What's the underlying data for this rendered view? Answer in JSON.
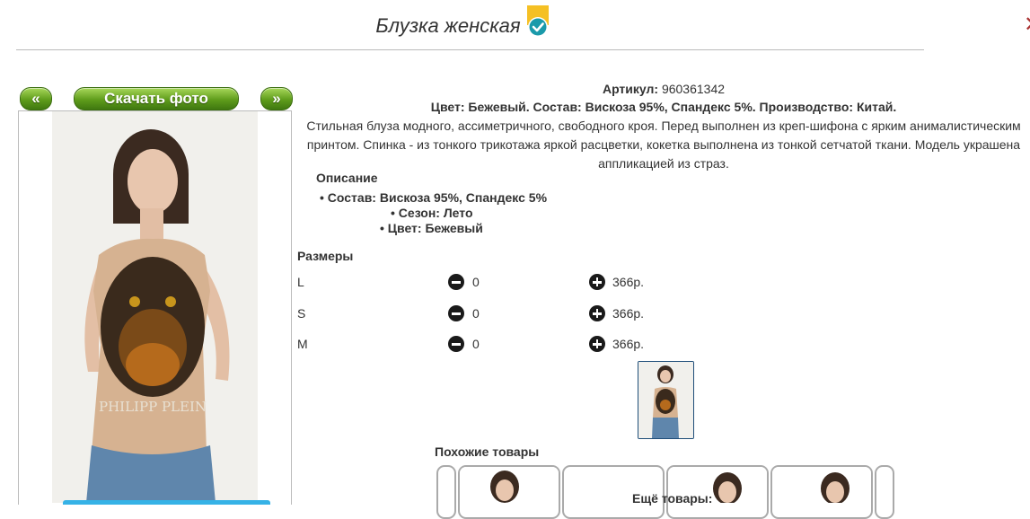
{
  "header": {
    "title": "Блузка женская"
  },
  "gallery": {
    "prev_label": "«",
    "download_label": "Скачать фото",
    "next_label": "»"
  },
  "product": {
    "article_label": "Артикул:",
    "article_value": "960361342",
    "spec_line": "Цвет: Бежевый. Состав: Вискоза 95%, Спандекс 5%. Производство: Китай.",
    "description_line1": "Стильная блуза модного, ассиметричного, свободного кроя. Перед выполнен из креп-шифона с ярким анималистическим",
    "description_line2": "принтом. Спинка - из тонкого трикотажа яркой расцветки, кокетка выполнена из тонкой сетчатой ткани. Модель украшена",
    "description_line3": "аппликацией из страз.",
    "features_title": "Описание",
    "features": [
      "Состав: Вискоза 95%, Спандекс 5%",
      "Сезон: Лето",
      "Цвет: Бежевый"
    ],
    "print_text": "PHILIPP PLEIN"
  },
  "sizes": {
    "title": "Размеры",
    "rows": [
      {
        "size": "L",
        "qty": "0",
        "price": "366р."
      },
      {
        "size": "S",
        "qty": "0",
        "price": "366р."
      },
      {
        "size": "M",
        "qty": "0",
        "price": "366р."
      }
    ]
  },
  "related": {
    "similar_title": "Похожие товары",
    "more_title": "Ещё товары:"
  },
  "colors": {
    "button_green": "#5f9c1b",
    "badge_yellow": "#f5c024",
    "badge_check": "#1a9aaa",
    "accent_blue": "#36b2e6"
  }
}
